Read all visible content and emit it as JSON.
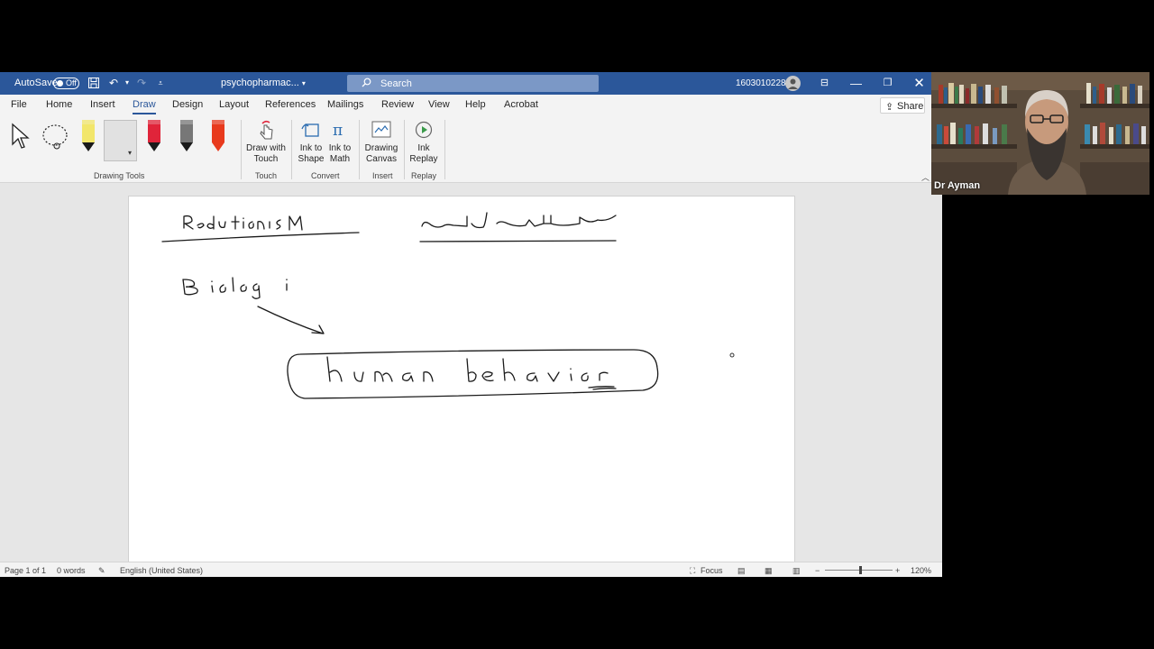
{
  "titlebar": {
    "autosave_label": "AutoSave",
    "autosave_state": "Off",
    "document_name": "psychopharmac...",
    "search_placeholder": "Search",
    "user_id": "1603010228"
  },
  "tabs": [
    "File",
    "Home",
    "Insert",
    "Draw",
    "Design",
    "Layout",
    "References",
    "Mailings",
    "Review",
    "View",
    "Help",
    "Acrobat"
  ],
  "active_tab": "Draw",
  "share_label": "Share",
  "ribbon": {
    "drawing_tools_label": "Drawing Tools",
    "touch": {
      "button_line1": "Draw with",
      "button_line2": "Touch",
      "group_label": "Touch"
    },
    "convert": {
      "ink_to_shape_line1": "Ink to",
      "ink_to_shape_line2": "Shape",
      "ink_to_math_line1": "Ink to",
      "ink_to_math_line2": "Math",
      "group_label": "Convert"
    },
    "insert": {
      "button_line1": "Drawing",
      "button_line2": "Canvas",
      "group_label": "Insert"
    },
    "replay": {
      "button_line1": "Ink",
      "button_line2": "Replay",
      "group_label": "Replay"
    },
    "pens": [
      {
        "color": "#f2e66b",
        "tip": "#1a1a1a"
      },
      {
        "color": "#111111",
        "tip": "#111111"
      },
      {
        "color": "#e0243a",
        "tip": "#1a1a1a"
      },
      {
        "color": "#777777",
        "tip": "#1a1a1a"
      },
      {
        "color": "#e83a1d",
        "tip": "#e83a1d"
      }
    ]
  },
  "status": {
    "page": "Page 1 of 1",
    "words": "0 words",
    "language": "English (United States)",
    "focus": "Focus",
    "zoom": "120%"
  },
  "video": {
    "participant_name": "Dr Ayman"
  },
  "colors": {
    "word_blue": "#2b579a",
    "ribbon_bg": "#f3f3f3",
    "page_bg": "#ffffff"
  }
}
